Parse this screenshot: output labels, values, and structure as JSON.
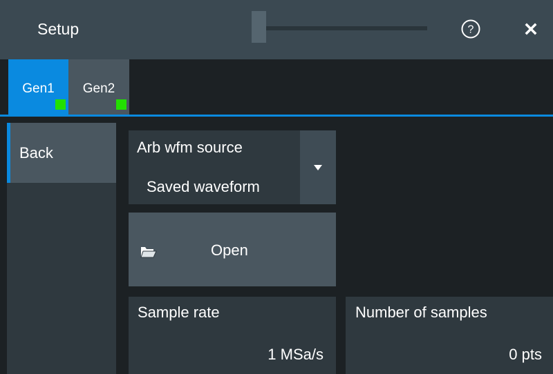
{
  "titlebar": {
    "title": "Setup",
    "help_icon": "help-circle-icon",
    "close_icon": "close-icon"
  },
  "tabs": [
    {
      "label": "Gen1",
      "active": true,
      "status_color": "#22e000"
    },
    {
      "label": "Gen2",
      "active": false,
      "status_color": "#22e000"
    }
  ],
  "sidebar": {
    "back_label": "Back"
  },
  "arb_source": {
    "label": "Arb wfm source",
    "value": "Saved waveform"
  },
  "open_button": {
    "label": "Open",
    "icon": "folder-open-icon"
  },
  "sample_rate": {
    "label": "Sample rate",
    "value": "1 MSa/s"
  },
  "num_samples": {
    "label": "Number of samples",
    "value": "0 pts"
  },
  "colors": {
    "accent": "#0a8ae0",
    "status_ok": "#22e000",
    "titlebar": "#3b4952",
    "panel": "#2f393f"
  }
}
